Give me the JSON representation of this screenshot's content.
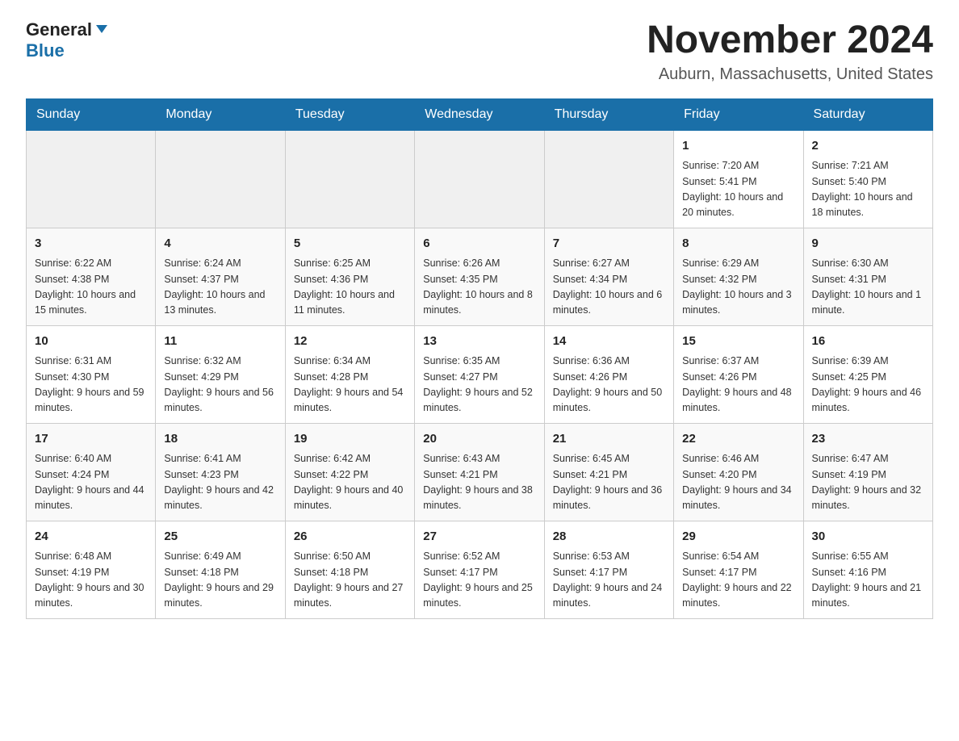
{
  "header": {
    "logo_general": "General",
    "logo_blue": "Blue",
    "month_title": "November 2024",
    "location": "Auburn, Massachusetts, United States"
  },
  "weekdays": [
    "Sunday",
    "Monday",
    "Tuesday",
    "Wednesday",
    "Thursday",
    "Friday",
    "Saturday"
  ],
  "weeks": [
    [
      {
        "day": "",
        "info": ""
      },
      {
        "day": "",
        "info": ""
      },
      {
        "day": "",
        "info": ""
      },
      {
        "day": "",
        "info": ""
      },
      {
        "day": "",
        "info": ""
      },
      {
        "day": "1",
        "info": "Sunrise: 7:20 AM\nSunset: 5:41 PM\nDaylight: 10 hours and 20 minutes."
      },
      {
        "day": "2",
        "info": "Sunrise: 7:21 AM\nSunset: 5:40 PM\nDaylight: 10 hours and 18 minutes."
      }
    ],
    [
      {
        "day": "3",
        "info": "Sunrise: 6:22 AM\nSunset: 4:38 PM\nDaylight: 10 hours and 15 minutes."
      },
      {
        "day": "4",
        "info": "Sunrise: 6:24 AM\nSunset: 4:37 PM\nDaylight: 10 hours and 13 minutes."
      },
      {
        "day": "5",
        "info": "Sunrise: 6:25 AM\nSunset: 4:36 PM\nDaylight: 10 hours and 11 minutes."
      },
      {
        "day": "6",
        "info": "Sunrise: 6:26 AM\nSunset: 4:35 PM\nDaylight: 10 hours and 8 minutes."
      },
      {
        "day": "7",
        "info": "Sunrise: 6:27 AM\nSunset: 4:34 PM\nDaylight: 10 hours and 6 minutes."
      },
      {
        "day": "8",
        "info": "Sunrise: 6:29 AM\nSunset: 4:32 PM\nDaylight: 10 hours and 3 minutes."
      },
      {
        "day": "9",
        "info": "Sunrise: 6:30 AM\nSunset: 4:31 PM\nDaylight: 10 hours and 1 minute."
      }
    ],
    [
      {
        "day": "10",
        "info": "Sunrise: 6:31 AM\nSunset: 4:30 PM\nDaylight: 9 hours and 59 minutes."
      },
      {
        "day": "11",
        "info": "Sunrise: 6:32 AM\nSunset: 4:29 PM\nDaylight: 9 hours and 56 minutes."
      },
      {
        "day": "12",
        "info": "Sunrise: 6:34 AM\nSunset: 4:28 PM\nDaylight: 9 hours and 54 minutes."
      },
      {
        "day": "13",
        "info": "Sunrise: 6:35 AM\nSunset: 4:27 PM\nDaylight: 9 hours and 52 minutes."
      },
      {
        "day": "14",
        "info": "Sunrise: 6:36 AM\nSunset: 4:26 PM\nDaylight: 9 hours and 50 minutes."
      },
      {
        "day": "15",
        "info": "Sunrise: 6:37 AM\nSunset: 4:26 PM\nDaylight: 9 hours and 48 minutes."
      },
      {
        "day": "16",
        "info": "Sunrise: 6:39 AM\nSunset: 4:25 PM\nDaylight: 9 hours and 46 minutes."
      }
    ],
    [
      {
        "day": "17",
        "info": "Sunrise: 6:40 AM\nSunset: 4:24 PM\nDaylight: 9 hours and 44 minutes."
      },
      {
        "day": "18",
        "info": "Sunrise: 6:41 AM\nSunset: 4:23 PM\nDaylight: 9 hours and 42 minutes."
      },
      {
        "day": "19",
        "info": "Sunrise: 6:42 AM\nSunset: 4:22 PM\nDaylight: 9 hours and 40 minutes."
      },
      {
        "day": "20",
        "info": "Sunrise: 6:43 AM\nSunset: 4:21 PM\nDaylight: 9 hours and 38 minutes."
      },
      {
        "day": "21",
        "info": "Sunrise: 6:45 AM\nSunset: 4:21 PM\nDaylight: 9 hours and 36 minutes."
      },
      {
        "day": "22",
        "info": "Sunrise: 6:46 AM\nSunset: 4:20 PM\nDaylight: 9 hours and 34 minutes."
      },
      {
        "day": "23",
        "info": "Sunrise: 6:47 AM\nSunset: 4:19 PM\nDaylight: 9 hours and 32 minutes."
      }
    ],
    [
      {
        "day": "24",
        "info": "Sunrise: 6:48 AM\nSunset: 4:19 PM\nDaylight: 9 hours and 30 minutes."
      },
      {
        "day": "25",
        "info": "Sunrise: 6:49 AM\nSunset: 4:18 PM\nDaylight: 9 hours and 29 minutes."
      },
      {
        "day": "26",
        "info": "Sunrise: 6:50 AM\nSunset: 4:18 PM\nDaylight: 9 hours and 27 minutes."
      },
      {
        "day": "27",
        "info": "Sunrise: 6:52 AM\nSunset: 4:17 PM\nDaylight: 9 hours and 25 minutes."
      },
      {
        "day": "28",
        "info": "Sunrise: 6:53 AM\nSunset: 4:17 PM\nDaylight: 9 hours and 24 minutes."
      },
      {
        "day": "29",
        "info": "Sunrise: 6:54 AM\nSunset: 4:17 PM\nDaylight: 9 hours and 22 minutes."
      },
      {
        "day": "30",
        "info": "Sunrise: 6:55 AM\nSunset: 4:16 PM\nDaylight: 9 hours and 21 minutes."
      }
    ]
  ]
}
